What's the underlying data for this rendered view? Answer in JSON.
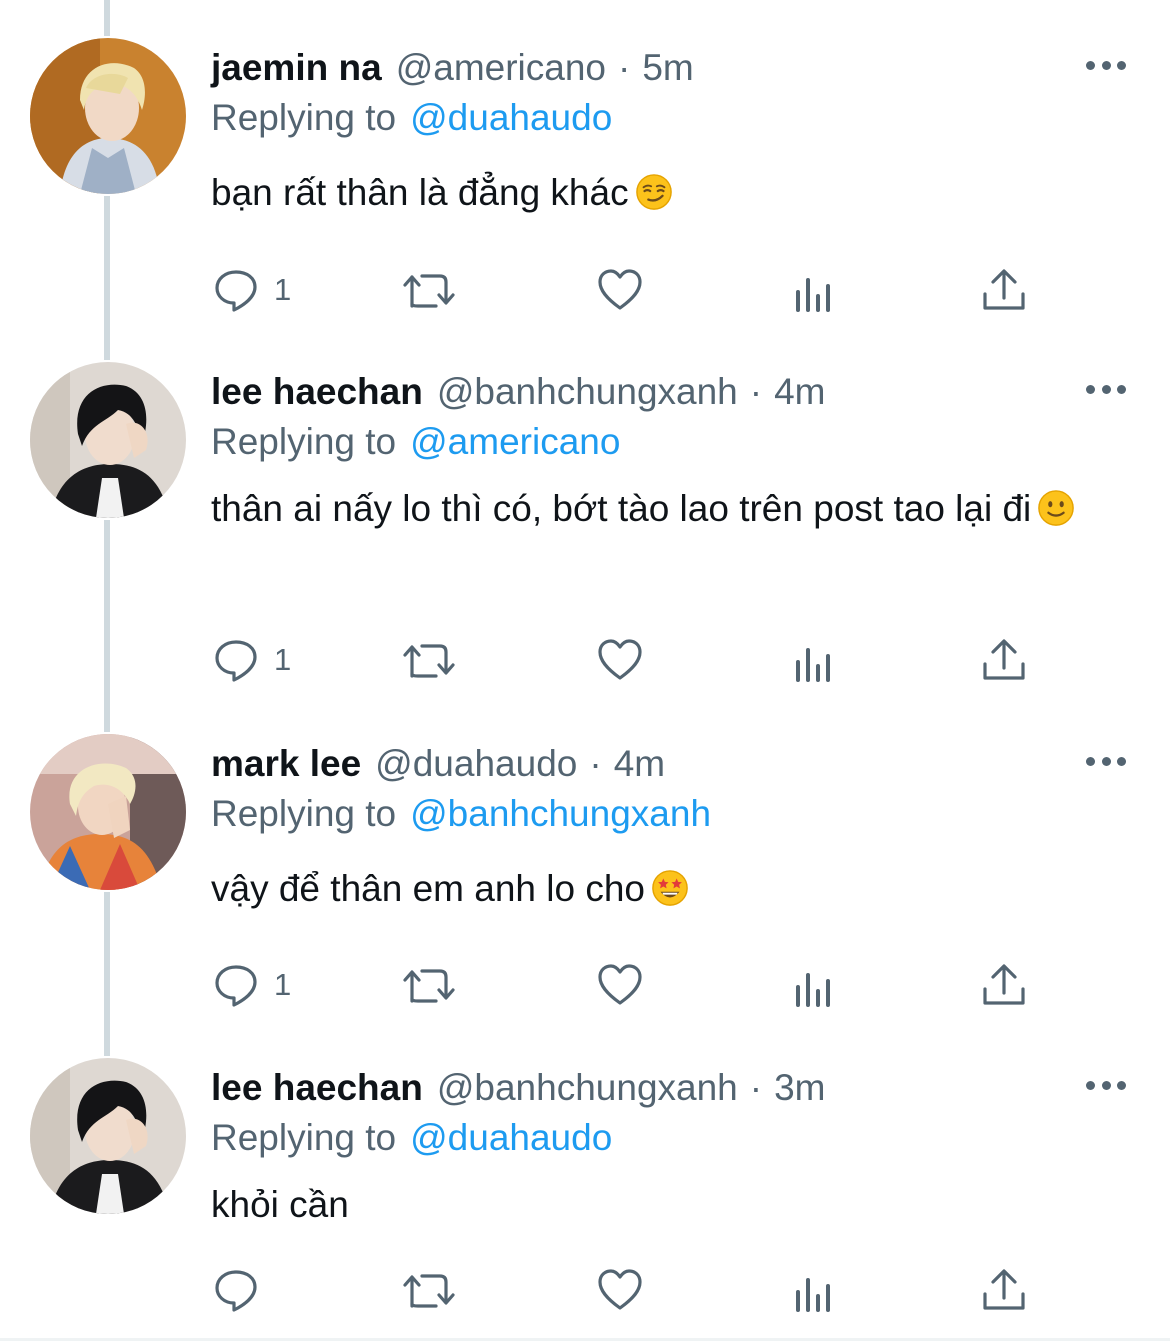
{
  "tweets": [
    {
      "name": "jaemin na",
      "handle": "@americano",
      "dot": "·",
      "time": "5m",
      "reply_label": "Replying to",
      "reply_to": "@duahaudo",
      "text": "bạn rất thân là đẳng khác",
      "emoji": "smirking-face-emoji",
      "reply_count": "1"
    },
    {
      "name": "lee haechan",
      "handle": "@banhchungxanh",
      "dot": "·",
      "time": "4m",
      "reply_label": "Replying to",
      "reply_to": "@americano",
      "text": "thân ai nấy lo thì có, bớt tào lao trên post tao lại đi",
      "emoji": "slightly-smiling-face-emoji",
      "reply_count": "1"
    },
    {
      "name": "mark lee",
      "handle": "@duahaudo",
      "dot": "·",
      "time": "4m",
      "reply_label": "Replying to",
      "reply_to": "@banhchungxanh",
      "text": "vậy để thân em anh lo cho",
      "emoji": "star-struck-emoji",
      "reply_count": "1"
    },
    {
      "name": "lee haechan",
      "handle": "@banhchungxanh",
      "dot": "·",
      "time": "3m",
      "reply_label": "Replying to",
      "reply_to": "@duahaudo",
      "text": "khỏi cần",
      "emoji": "",
      "reply_count": ""
    }
  ],
  "icons": {
    "reply": "reply-icon",
    "retweet": "retweet-icon",
    "like": "heart-icon",
    "views": "views-icon",
    "share": "share-icon",
    "more": "more-icon"
  },
  "colors": {
    "text": "#0f1419",
    "secondary": "#536471",
    "link": "#1d9bf0",
    "thread_line": "#cfd9de"
  }
}
